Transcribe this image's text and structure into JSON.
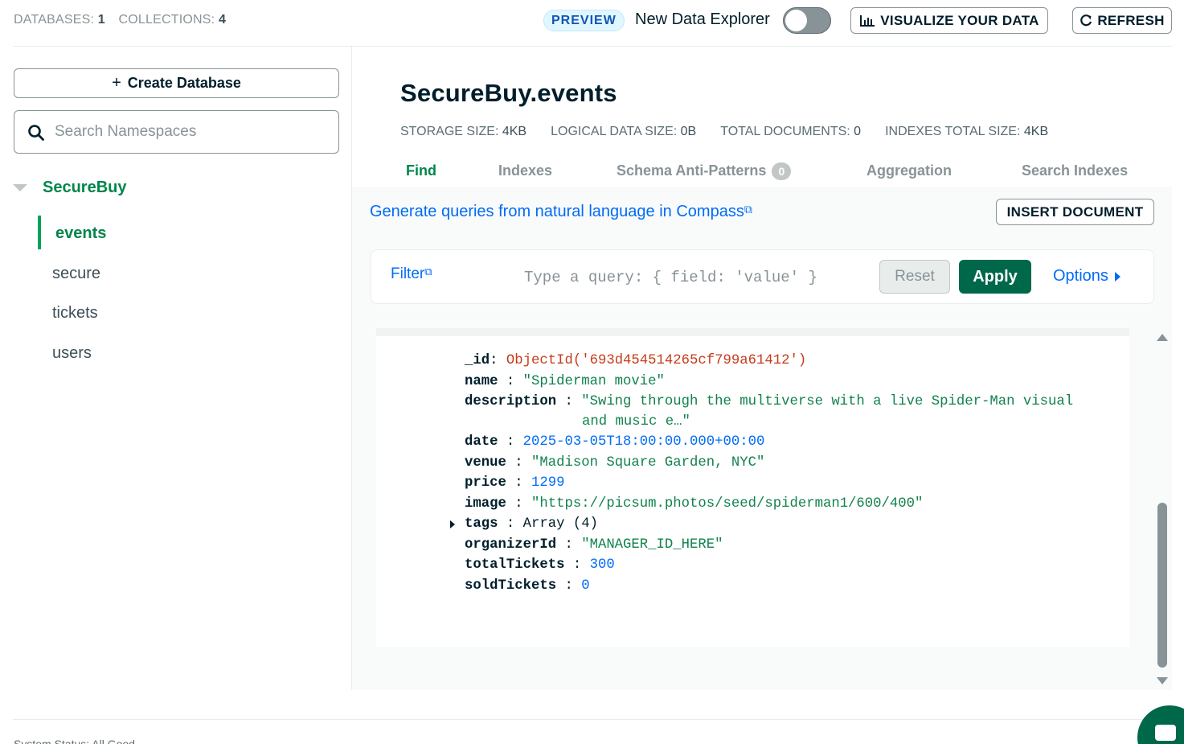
{
  "header": {
    "databases_label": "DATABASES:",
    "databases_count": "1",
    "collections_label": "COLLECTIONS:",
    "collections_count": "4",
    "preview_badge": "PREVIEW",
    "new_explorer_label": "New Data Explorer",
    "new_explorer_enabled": false,
    "visualize_label": "VISUALIZE YOUR DATA",
    "refresh_label": "REFRESH"
  },
  "sidebar": {
    "create_db_label": "Create Database",
    "search_placeholder": "Search Namespaces",
    "database": "SecureBuy",
    "collections": [
      {
        "label": "events",
        "active": true
      },
      {
        "label": "secure",
        "active": false
      },
      {
        "label": "tickets",
        "active": false
      },
      {
        "label": "users",
        "active": false
      }
    ]
  },
  "main": {
    "namespace": "SecureBuy.events",
    "stats": [
      {
        "label": "STORAGE SIZE:",
        "value": "4KB"
      },
      {
        "label": "LOGICAL DATA SIZE:",
        "value": "0B"
      },
      {
        "label": "TOTAL DOCUMENTS:",
        "value": "0"
      },
      {
        "label": "INDEXES TOTAL SIZE:",
        "value": "4KB"
      }
    ],
    "tabs": [
      {
        "label": "Find",
        "active": true
      },
      {
        "label": "Indexes",
        "active": false
      },
      {
        "label": "Schema Anti-Patterns",
        "badge": "0",
        "active": false
      },
      {
        "label": "Aggregation",
        "active": false
      },
      {
        "label": "Search Indexes",
        "active": false
      }
    ],
    "nl_query_link": "Generate queries from natural language in Compass",
    "insert_label": "INSERT DOCUMENT",
    "query": {
      "filter_label": "Filter",
      "placeholder": "Type a query: { field: 'value' }",
      "reset_label": "Reset",
      "apply_label": "Apply",
      "options_label": "Options"
    },
    "document": {
      "id_key": "_id",
      "id_value": "ObjectId('693d454514265cf799a61412')",
      "name_key": "name",
      "name_value": "\"Spiderman movie\"",
      "description_key": "description",
      "description_line1": "\"Swing through the multiverse with a live Spider-Man visual",
      "description_line2": "and music e…\"",
      "date_key": "date",
      "date_value": "2025-03-05T18:00:00.000+00:00",
      "venue_key": "venue",
      "venue_value": "\"Madison Square Garden, NYC\"",
      "price_key": "price",
      "price_value": "1299",
      "image_key": "image",
      "image_value": "\"https://picsum.photos/seed/spiderman1/600/400\"",
      "tags_key": "tags",
      "tags_value": "Array (4)",
      "organizer_key": "organizerId",
      "organizer_value": "\"MANAGER_ID_HERE\"",
      "total_key": "totalTickets",
      "total_value": "300",
      "sold_key": "soldTickets",
      "sold_value": "0"
    }
  },
  "footer": {
    "text": "System Status: All Good"
  },
  "colors": {
    "brand_green": "#00684a",
    "link_blue": "#016bf8",
    "active_green": "#00864a"
  }
}
